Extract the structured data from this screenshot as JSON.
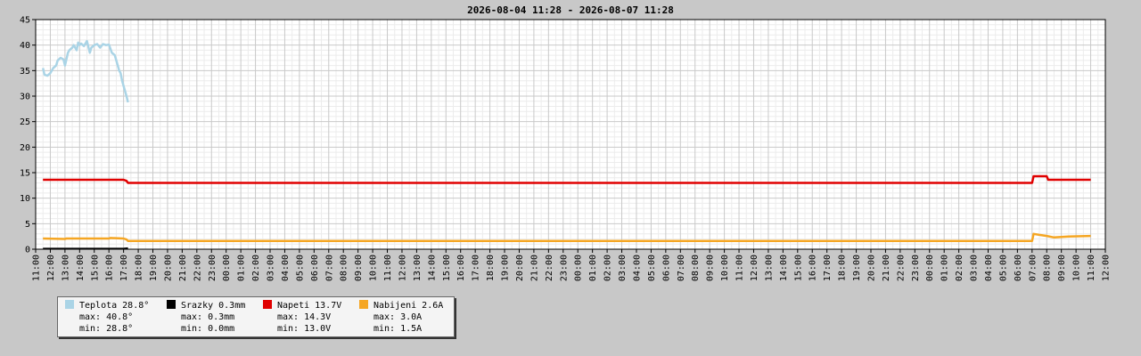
{
  "chart_data": {
    "type": "line",
    "title": "2026-08-04 11:28 - 2026-08-07 11:28",
    "xlabel": "",
    "ylabel": "",
    "ylim": [
      0,
      45
    ],
    "yticks": [
      0,
      5,
      10,
      15,
      20,
      25,
      30,
      35,
      40,
      45
    ],
    "x_unit": "hours",
    "xlim": [
      0,
      73
    ],
    "x_tick_labels": [
      "11:00",
      "12:00",
      "13:00",
      "14:00",
      "15:00",
      "16:00",
      "17:00",
      "18:00",
      "19:00",
      "20:00",
      "21:00",
      "22:00",
      "23:00",
      "00:00",
      "01:00",
      "02:00",
      "03:00",
      "04:00",
      "05:00",
      "06:00",
      "07:00",
      "08:00",
      "09:00",
      "10:00",
      "11:00",
      "12:00",
      "13:00",
      "14:00",
      "15:00",
      "16:00",
      "17:00",
      "18:00",
      "19:00",
      "20:00",
      "21:00",
      "22:00",
      "23:00",
      "00:00",
      "01:00",
      "02:00",
      "03:00",
      "04:00",
      "05:00",
      "06:00",
      "07:00",
      "08:00",
      "09:00",
      "10:00",
      "11:00",
      "12:00",
      "13:00",
      "14:00",
      "15:00",
      "16:00",
      "17:00",
      "18:00",
      "19:00",
      "20:00",
      "21:00",
      "22:00",
      "23:00",
      "00:00",
      "01:00",
      "02:00",
      "03:00",
      "04:00",
      "05:00",
      "06:00",
      "07:00",
      "08:00",
      "09:00",
      "10:00",
      "11:00",
      "12:00"
    ],
    "grid": true,
    "legend_position": "bottom-left",
    "series": [
      {
        "name": "Teplota 28.8°",
        "color": "#aad4e6",
        "max": "max: 40.8°",
        "min": "min: 28.8°",
        "x": [
          0.5,
          0.6,
          0.8,
          1.0,
          1.2,
          1.4,
          1.5,
          1.7,
          1.9,
          2.0,
          2.2,
          2.3,
          2.5,
          2.6,
          2.8,
          2.9,
          3.0,
          3.1,
          3.3,
          3.5,
          3.7,
          3.8,
          4.0,
          4.2,
          4.4,
          4.6,
          4.8,
          5.0,
          5.2,
          5.4,
          5.6,
          5.7,
          5.8,
          5.9,
          6.0,
          6.1,
          6.2,
          6.3
        ],
        "values": [
          35.5,
          34.2,
          34.0,
          34.5,
          35.5,
          36.0,
          37.0,
          37.5,
          37.2,
          36.0,
          38.5,
          39.0,
          39.5,
          40.0,
          39.0,
          40.5,
          40.0,
          40.3,
          39.8,
          40.8,
          38.5,
          39.5,
          40.0,
          40.2,
          39.5,
          40.2,
          40.0,
          40.1,
          38.5,
          38.0,
          36.0,
          35.0,
          34.5,
          33.0,
          32.0,
          31.0,
          30.0,
          28.8
        ]
      },
      {
        "name": "Srazky 0.3mm",
        "color": "#000000",
        "max": "max: 0.3mm",
        "min": "min: 0.0mm",
        "x": [
          0.5,
          2.0,
          4.0,
          6.0,
          6.3
        ],
        "values": [
          0.1,
          0.1,
          0.1,
          0.1,
          0.2
        ]
      },
      {
        "name": "Napeti 13.7V",
        "color": "#e00000",
        "max": "max: 14.3V",
        "min": "min: 13.0V",
        "x": [
          0.5,
          6.0,
          6.2,
          6.3,
          68.0,
          68.1,
          69.0,
          69.1,
          72.0
        ],
        "values": [
          13.6,
          13.6,
          13.4,
          13.0,
          13.0,
          14.3,
          14.3,
          13.6,
          13.6
        ]
      },
      {
        "name": "Nabijeni 2.6A",
        "color": "#f5a623",
        "max": "max: 3.0A",
        "min": "min: 1.5A",
        "x": [
          0.5,
          2.0,
          2.1,
          5.0,
          5.1,
          6.0,
          6.2,
          6.3,
          68.0,
          68.1,
          68.5,
          69.0,
          69.5,
          70.0,
          70.5,
          72.0
        ],
        "values": [
          2.1,
          2.0,
          2.1,
          2.1,
          2.2,
          2.1,
          1.9,
          1.6,
          1.6,
          3.0,
          2.8,
          2.6,
          2.3,
          2.4,
          2.5,
          2.6
        ]
      }
    ]
  }
}
